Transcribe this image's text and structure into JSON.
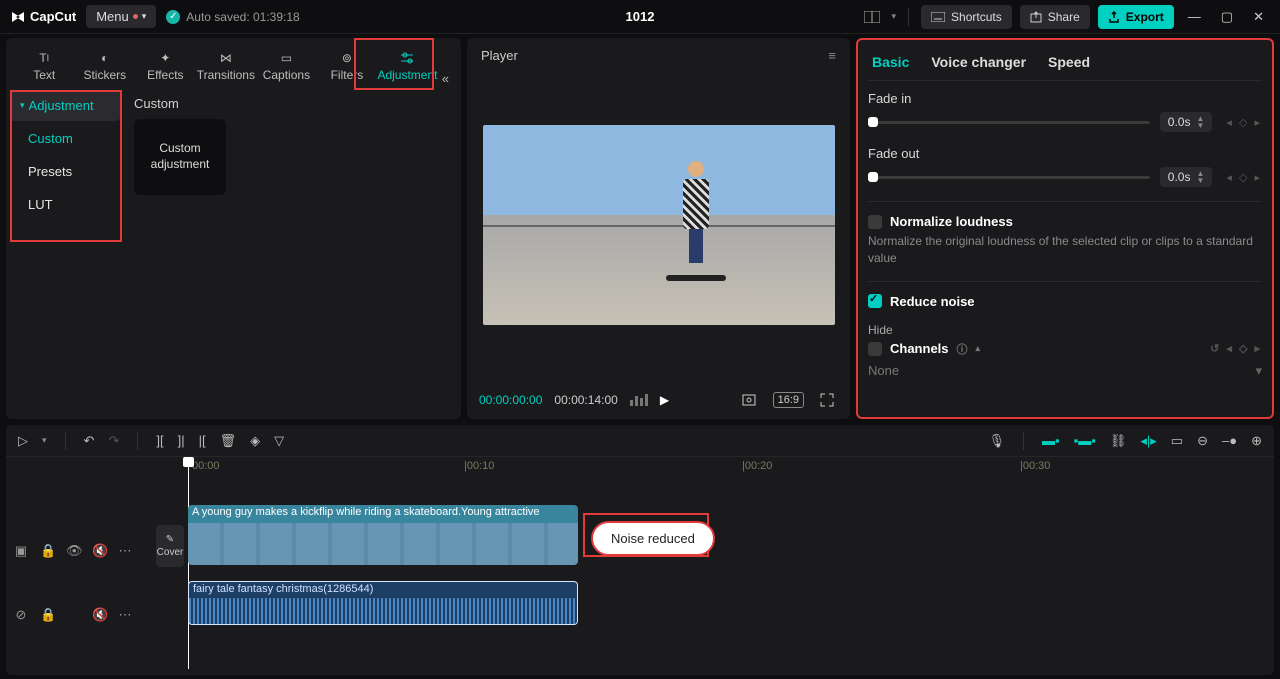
{
  "header": {
    "app_name": "CapCut",
    "menu_label": "Menu",
    "autosave_label": "Auto saved: 01:39:18",
    "doc_title": "1012",
    "shortcuts_label": "Shortcuts",
    "share_label": "Share",
    "export_label": "Export"
  },
  "tooltabs": {
    "text": "Text",
    "stickers": "Stickers",
    "effects": "Effects",
    "transitions": "Transitions",
    "captions": "Captions",
    "filters": "Filters",
    "adjustment": "Adjustment"
  },
  "sidebar": {
    "section": "Adjustment",
    "custom": "Custom",
    "presets": "Presets",
    "lut": "LUT"
  },
  "left_content": {
    "heading": "Custom",
    "thumb_label": "Custom adjustment"
  },
  "player": {
    "title": "Player",
    "tc_current": "00:00:00:00",
    "tc_total": "00:00:14:00",
    "ratio": "16:9"
  },
  "inspector": {
    "tab_basic": "Basic",
    "tab_voice": "Voice changer",
    "tab_speed": "Speed",
    "fade_in_label": "Fade in",
    "fade_in_value": "0.0s",
    "fade_out_label": "Fade out",
    "fade_out_value": "0.0s",
    "normalize_label": "Normalize loudness",
    "normalize_desc": "Normalize the original loudness of the selected clip or clips to a standard value",
    "reduce_noise_label": "Reduce noise",
    "hide_label": "Hide",
    "channels_label": "Channels",
    "channels_value": "None"
  },
  "timeline": {
    "ruler": {
      "t0": "00:00",
      "t10": "|00:10",
      "t20": "|00:20",
      "t30": "|00:30"
    },
    "cover_label": "Cover",
    "video_clip_label": "A young guy makes a kickflip while riding a skateboard.Young attractive",
    "audio_clip_label": "fairy tale fantasy christmas(1286544)",
    "toast": "Noise reduced"
  }
}
